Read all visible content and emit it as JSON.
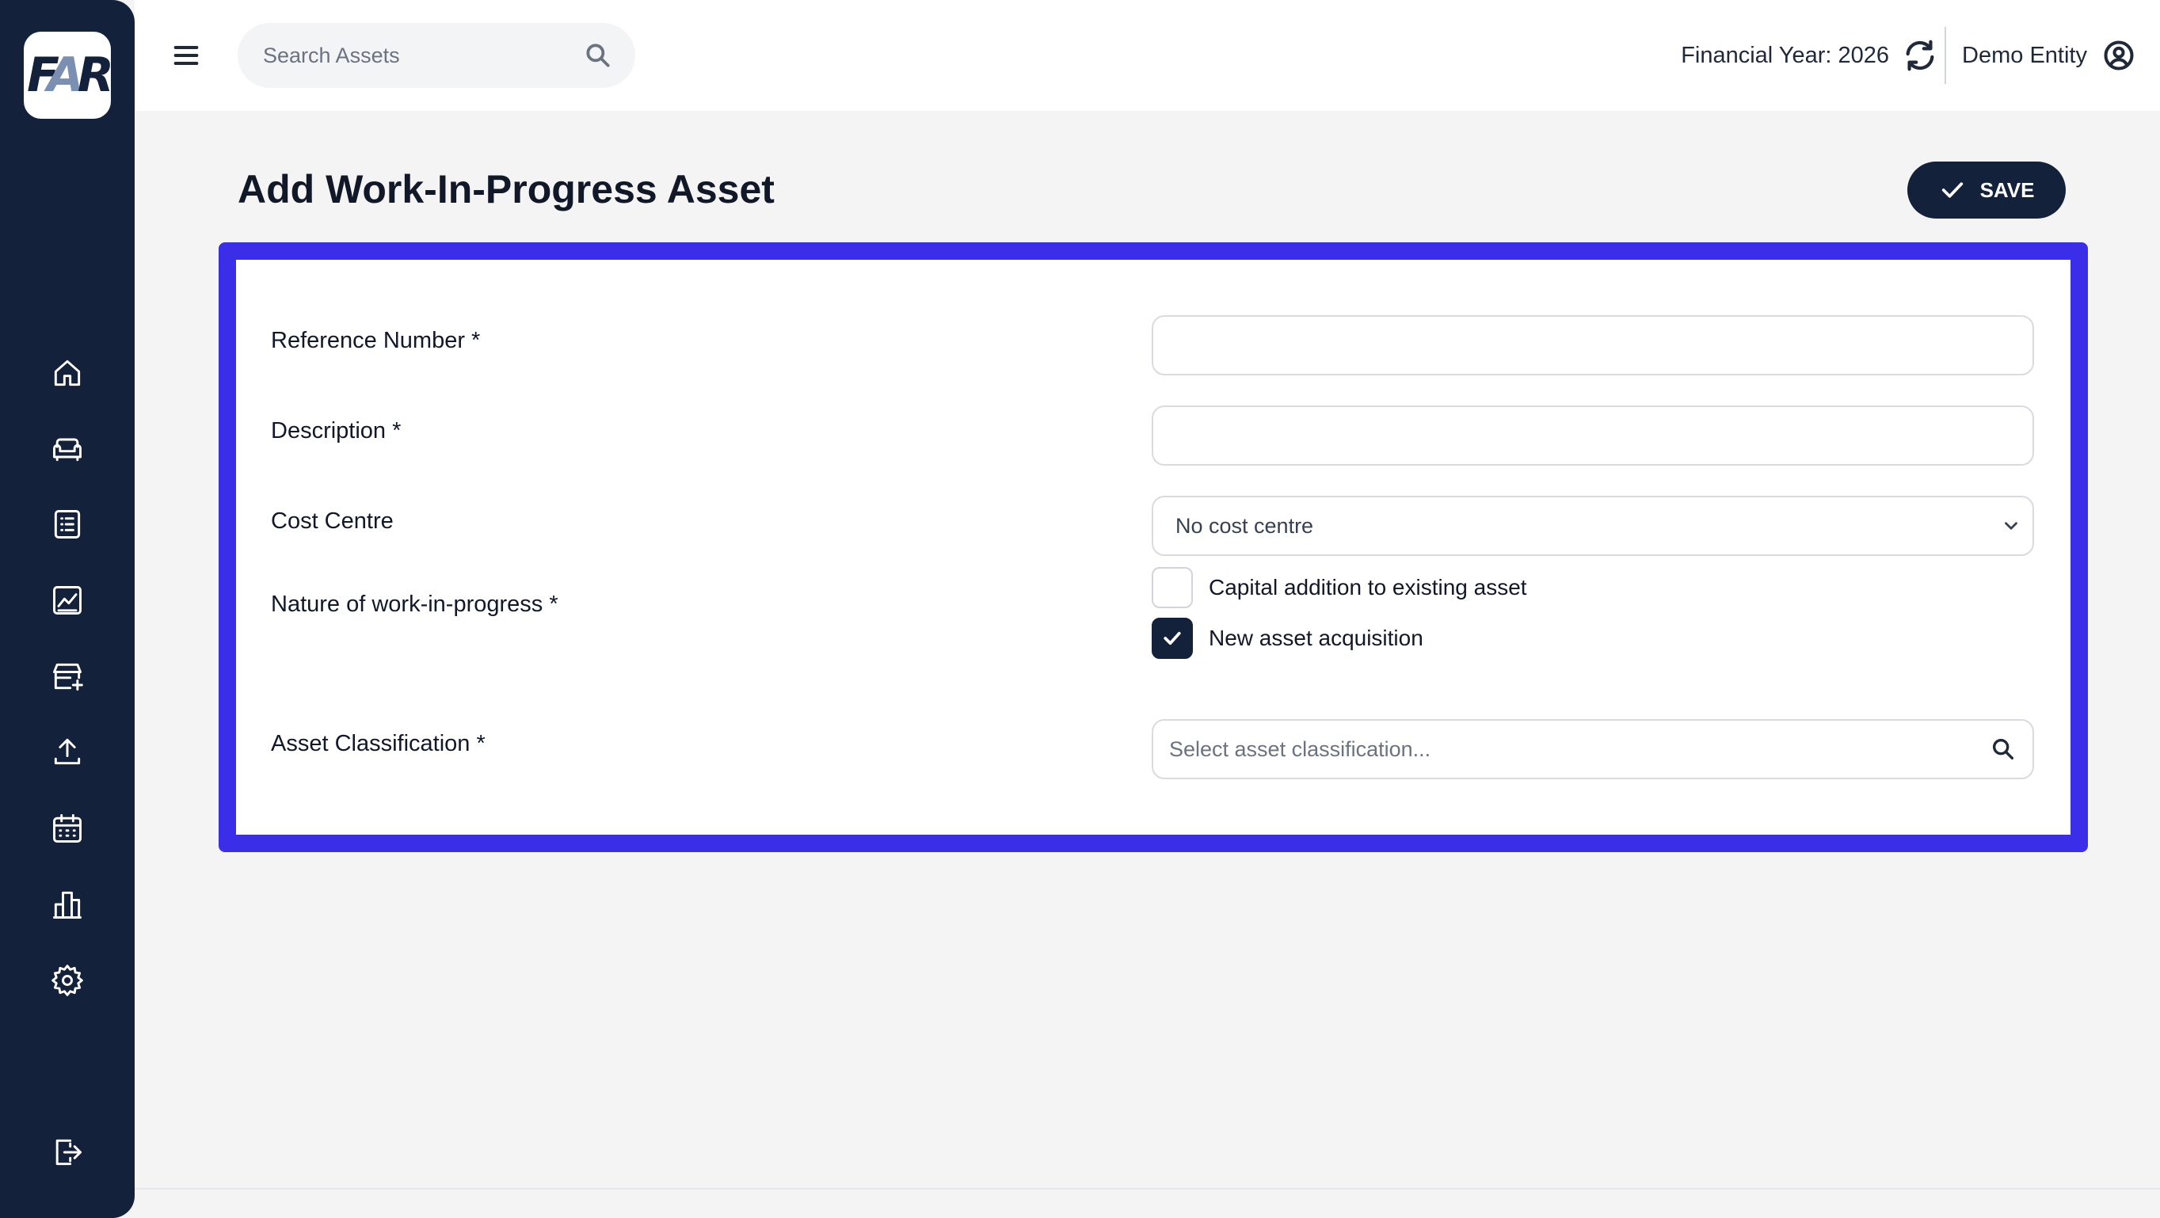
{
  "app": {
    "logo_text": "FAR"
  },
  "sidebar": {
    "items": [
      {
        "name": "home-icon"
      },
      {
        "name": "assets-icon"
      },
      {
        "name": "register-list-icon"
      },
      {
        "name": "reports-chart-icon"
      },
      {
        "name": "add-asset-store-icon"
      },
      {
        "name": "upload-icon"
      },
      {
        "name": "calendar-icon"
      },
      {
        "name": "bar-chart-icon"
      },
      {
        "name": "gear-icon"
      },
      {
        "name": "logout-icon"
      }
    ]
  },
  "header": {
    "search_placeholder": "Search Assets",
    "financial_year_label": "Financial Year: 2026",
    "entity_name": "Demo Entity"
  },
  "page": {
    "title": "Add Work-In-Progress Asset",
    "save_label": "SAVE"
  },
  "form": {
    "reference_number": {
      "label": "Reference Number *",
      "value": ""
    },
    "description": {
      "label": "Description *",
      "value": ""
    },
    "cost_centre": {
      "label": "Cost Centre",
      "selected": "No cost centre"
    },
    "nature": {
      "label": "Nature of work-in-progress *",
      "options": [
        {
          "label": "Capital addition to existing asset",
          "checked": false
        },
        {
          "label": "New asset acquisition",
          "checked": true
        }
      ]
    },
    "asset_classification": {
      "label": "Asset Classification *",
      "placeholder": "Select asset classification..."
    }
  },
  "colors": {
    "sidebar_bg": "#14213a",
    "highlight_border": "#3b2ee8",
    "primary": "#14213a"
  }
}
